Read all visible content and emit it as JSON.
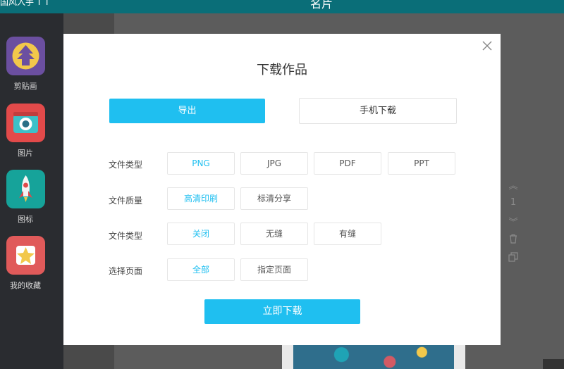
{
  "app": {
    "top_left_text": "国风入手  T  T",
    "top_center_text": "名片"
  },
  "sidebar": {
    "items": [
      {
        "label": "剪贴画",
        "icon": "pagoda-icon",
        "color": "#6b4fa0"
      },
      {
        "label": "图片",
        "icon": "camera-icon",
        "color": "#e24a4a"
      },
      {
        "label": "图标",
        "icon": "rocket-icon",
        "color": "#16a39a"
      },
      {
        "label": "我的收藏",
        "icon": "star-icon",
        "color": "#e05a5a"
      }
    ]
  },
  "toolbar": {
    "page_number": "1"
  },
  "modal": {
    "title": "下载作品",
    "tabs": {
      "export_label": "导出",
      "mobile_label": "手机下载"
    },
    "rows": [
      {
        "label": "文件类型",
        "options": [
          "PNG",
          "JPG",
          "PDF",
          "PPT"
        ],
        "selected": 0
      },
      {
        "label": "文件质量",
        "options": [
          "高清印刷",
          "标清分享"
        ],
        "selected": 0
      },
      {
        "label": "文件类型",
        "options": [
          "关闭",
          "无缝",
          "有缝"
        ],
        "selected": 0
      },
      {
        "label": "选择页面",
        "options": [
          "全部",
          "指定页面"
        ],
        "selected": 0
      }
    ],
    "download_label": "立即下载"
  },
  "colors": {
    "accent": "#1fbff0",
    "topbar": "#0a6e78"
  }
}
